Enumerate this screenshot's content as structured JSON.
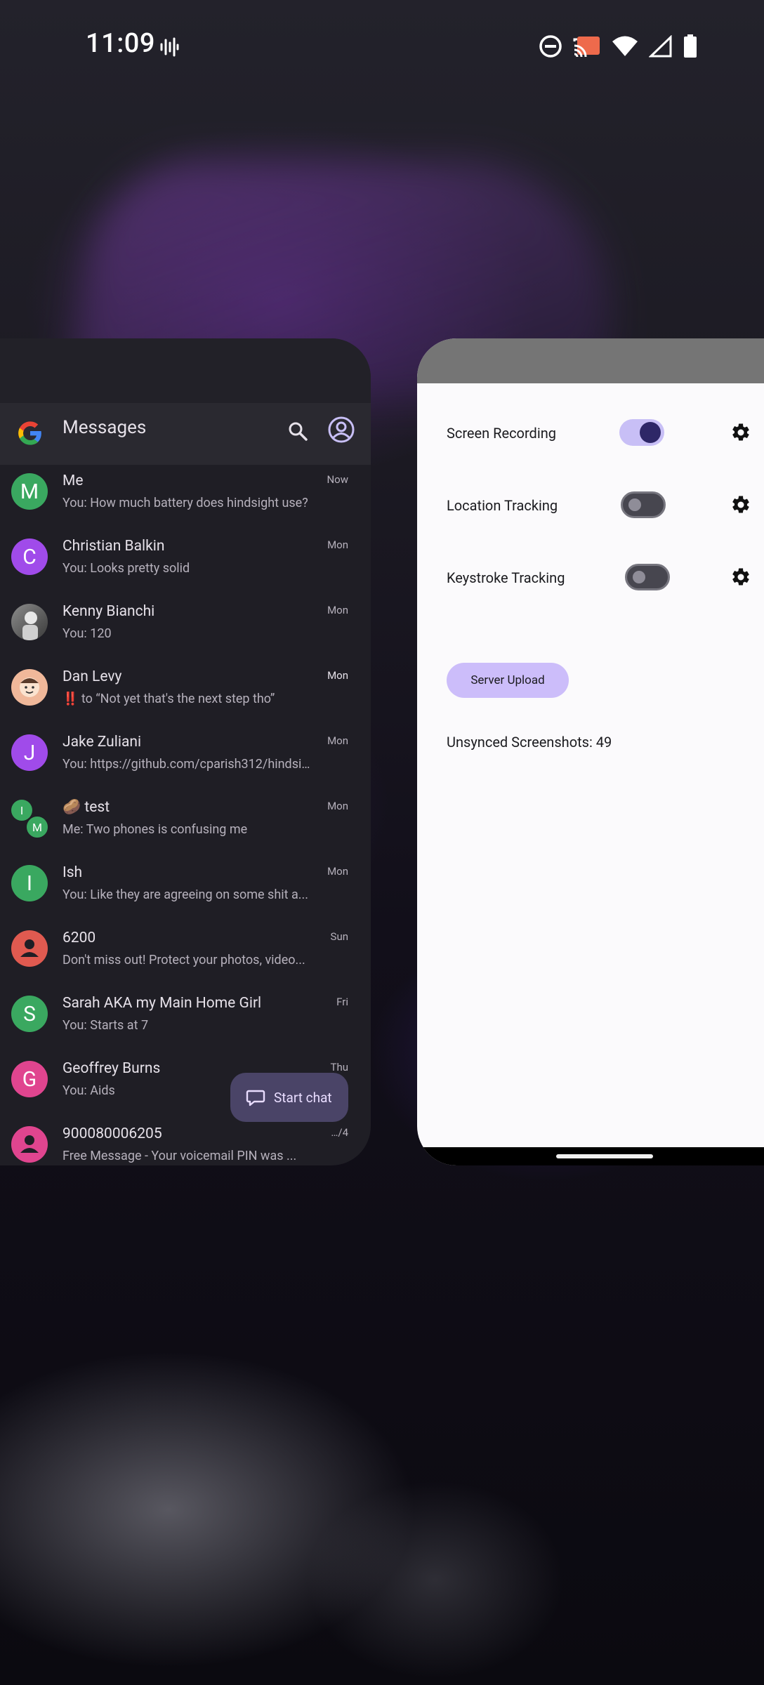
{
  "status_bar": {
    "time": "11:09"
  },
  "messages": {
    "app_title": "Messages",
    "conversations": [
      {
        "name": "Me",
        "snippet": "You: How much battery does hindsight use?",
        "time": "Now",
        "avatar_letter": "M",
        "avatar_color": "#3aa860"
      },
      {
        "name": "Christian Balkin",
        "snippet": "You: Looks pretty solid",
        "time": "Mon",
        "avatar_letter": "C",
        "avatar_color": "#a04bea"
      },
      {
        "name": "Kenny Bianchi",
        "snippet": "You: 120",
        "time": "Mon",
        "avatar_letter": "",
        "avatar_color": "#6f6f6f"
      },
      {
        "name": "Dan Levy",
        "snippet": "‼️ to “Not yet that's the next step tho”",
        "time": "Mon",
        "avatar_letter": "",
        "avatar_color": "#f0b89a"
      },
      {
        "name": "Jake Zuliani",
        "snippet": "You: https://github.com/cparish312/hindsig...",
        "time": "Mon",
        "avatar_letter": "J",
        "avatar_color": "#a04bea"
      },
      {
        "name": "🥔 test",
        "snippet": "Me: Two phones is confusing me",
        "time": "Mon",
        "avatar_letter": "I",
        "avatar_letter_2": "M",
        "avatar_color": "#3aa860"
      },
      {
        "name": "Ish",
        "snippet": "You: Like they are agreeing on some shit a...",
        "time": "Mon",
        "avatar_letter": "I",
        "avatar_color": "#3aa860"
      },
      {
        "name": "6200",
        "snippet": "Don't miss out! Protect your photos, video...",
        "time": "Sun",
        "avatar_letter": "",
        "avatar_color": "#e05a50"
      },
      {
        "name": "Sarah AKA my Main Home Girl",
        "snippet": "You: Starts at 7",
        "time": "Fri",
        "avatar_letter": "S",
        "avatar_color": "#3aa860"
      },
      {
        "name": "Geoffrey Burns",
        "snippet": "You: Aids",
        "time": "Thu",
        "avatar_letter": "G",
        "avatar_color": "#e0458f"
      },
      {
        "name": "900080006205",
        "snippet": "Free Message - Your voicemail PIN was ...",
        "time": "…/4",
        "avatar_letter": "",
        "avatar_color": "#e0458f"
      }
    ],
    "fab_label": "Start chat"
  },
  "hindsight": {
    "toggles": [
      {
        "label": "Screen Recording",
        "state": "on"
      },
      {
        "label": "Location Tracking",
        "state": "off"
      },
      {
        "label": "Keystroke Tracking",
        "state": "off"
      }
    ],
    "upload_button": "Server Upload",
    "unsynced": "Unsynced Screenshots: 49"
  }
}
